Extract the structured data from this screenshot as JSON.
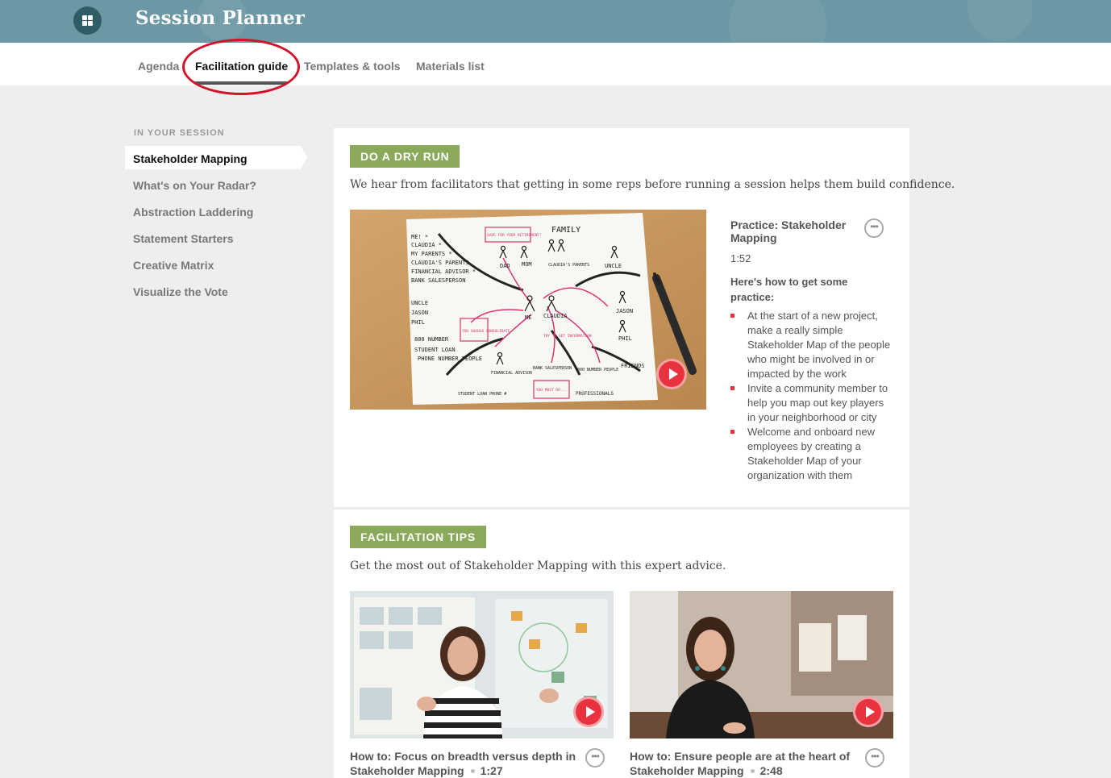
{
  "header": {
    "app_title": "Session Planner",
    "icon": "grid-icon"
  },
  "tabs": [
    {
      "label": "Agenda"
    },
    {
      "label": "Facilitation guide",
      "active": true
    },
    {
      "label": "Templates & tools"
    },
    {
      "label": "Materials list"
    }
  ],
  "sidebar": {
    "heading": "IN YOUR SESSION",
    "items": [
      {
        "label": "Stakeholder Mapping",
        "active": true
      },
      {
        "label": "What's on Your Radar?"
      },
      {
        "label": "Abstraction Laddering"
      },
      {
        "label": "Statement Starters"
      },
      {
        "label": "Creative Matrix"
      },
      {
        "label": "Visualize the Vote"
      }
    ]
  },
  "dry_run": {
    "label": "DO A DRY RUN",
    "intro": "We hear from facilitators that getting in some reps before running a session helps them build confidence.",
    "video": {
      "title": "Practice: Stakeholder Mapping",
      "duration": "1:52"
    },
    "howto_heading": "Here's how to get some practice:",
    "bullets": [
      "At the start of a new project, make a really simple Stakeholder Map of the people who might be involved in or impacted by the work",
      "Invite a community member to help you map out key players in your neighborhood or city",
      "Welcome and onboard new employees by creating a Stakeholder Map of your organization with them"
    ],
    "sketch": {
      "family": "FAMILY",
      "left_list": [
        "ME! *",
        "CLAUDIA *",
        "MY PARENTS *",
        "CLAUDIA'S PARENTS",
        "FINANCIAL ADVISOR *",
        "BANK SALESPERSON",
        "UNCLE",
        "JASON",
        "PHIL",
        "800 NUMBER",
        "STUDENT LOAN",
        "PHONE NUMBER PEOPLE"
      ],
      "nodes": [
        "DAD",
        "MOM",
        "CLAUDIA'S PARENTS",
        "UNCLE",
        "ME",
        "CLAUDIA",
        "JASON",
        "PHIL",
        "FRIENDS",
        "FINANCIAL ADVISOR",
        "BANK SALESPERSON",
        "800 NUMBER PEOPLE",
        "PROFESSIONALS",
        "STUDENT LOAN PHONE #"
      ],
      "notes": [
        "SAVE FOR YOUR RETIREMENT!",
        "YOU SHOULD CONSOLIDATE",
        "TRY TO GET INFORMATION",
        "YOU MUST DO..."
      ]
    }
  },
  "tips": {
    "label": "FACILITATION TIPS",
    "intro": "Get the most out of Stakeholder Mapping with this expert advice.",
    "videos": [
      {
        "title_line1": "How to: Focus on breadth versus depth in",
        "title_line2": "Stakeholder Mapping",
        "duration": "1:27"
      },
      {
        "title_line1": "How to: Ensure people are at the heart of",
        "title_line2": "Stakeholder Mapping",
        "duration": "2:48"
      }
    ]
  },
  "colors": {
    "header": "#6b98a4",
    "label_green": "#8aa95a",
    "play_red": "#e8333f",
    "annotation_red": "#d0142a"
  }
}
